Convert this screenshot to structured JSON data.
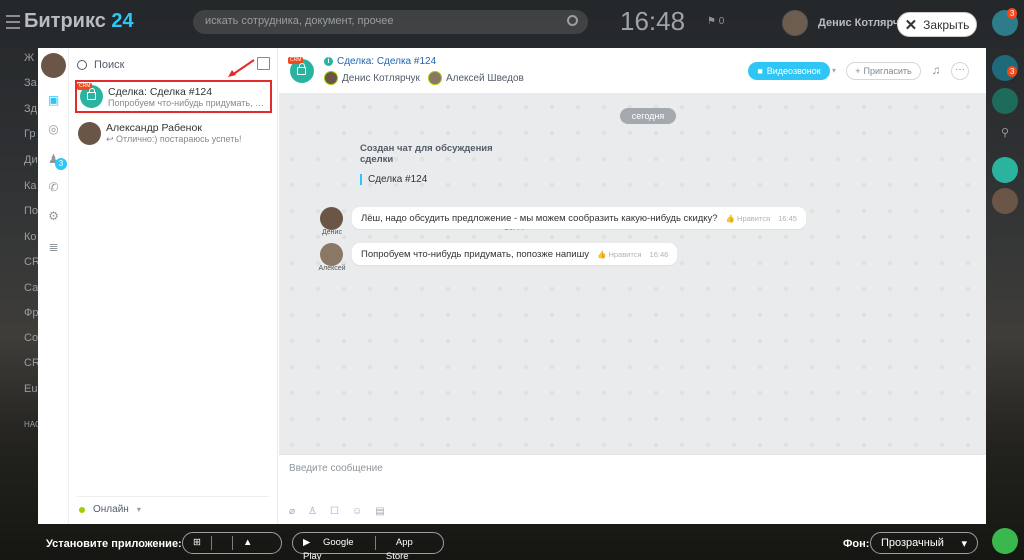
{
  "topbar": {
    "logo_text": "Битрикс",
    "logo_num": "24",
    "search_placeholder": "искать сотрудника, документ, прочее",
    "clock": "16:48",
    "flag_count": "0",
    "user_name": "Денис Котлярчук",
    "close_label": "Закрыть",
    "notif_count": "3"
  },
  "behind_menu": [
    "Ж",
    "За",
    "Зд",
    "Гр",
    "Ди",
    "Ка",
    "По",
    "Ко",
    "CR",
    "Са",
    "Фр",
    "Со",
    "CR",
    "Eu",
    "НАС"
  ],
  "iconbar": {
    "notif_badge": "3"
  },
  "list": {
    "search_label": "Поиск",
    "items": [
      {
        "title": "Сделка: Сделка #124",
        "subtitle": "Попробуем что-нибудь придумать, по...",
        "tag": "CRM"
      },
      {
        "title": "Александр Рабенок",
        "subtitle": "Отлично:) постараюсь успеть!"
      }
    ],
    "status": "Онлайн"
  },
  "chat": {
    "title": "Сделка: Сделка #124",
    "member1": "Денис Котлярчук",
    "member2": "Алексей Шведов",
    "video_label": "Видеозвонок",
    "invite_label": "Пригласить",
    "date_label": "сегодня",
    "system_header": "Создан чат для обсуждения сделки",
    "system_quote": "Сделка #124",
    "system_time": "16:44",
    "messages": [
      {
        "author": "Денис",
        "text": "Лёш, надо обсудить предложение - мы можем сообразить какую-нибудь скидку?",
        "like": "Нравится",
        "time": "16:45"
      },
      {
        "author": "Алексей",
        "text": "Попробуем что-нибудь придумать, попозже напишу",
        "like": "Нравится",
        "time": "16:46"
      }
    ],
    "input_placeholder": "Введите сообщение"
  },
  "bottombar": {
    "install_label": "Установите приложение:",
    "google_play": "Google Play",
    "app_store": "App Store",
    "bg_label": "Фон:",
    "bg_value": "Прозрачный"
  },
  "colors": {
    "accent": "#2fc6f6",
    "crm": "#f54819",
    "online": "#9dcf00",
    "highlight": "#e52a2a"
  }
}
